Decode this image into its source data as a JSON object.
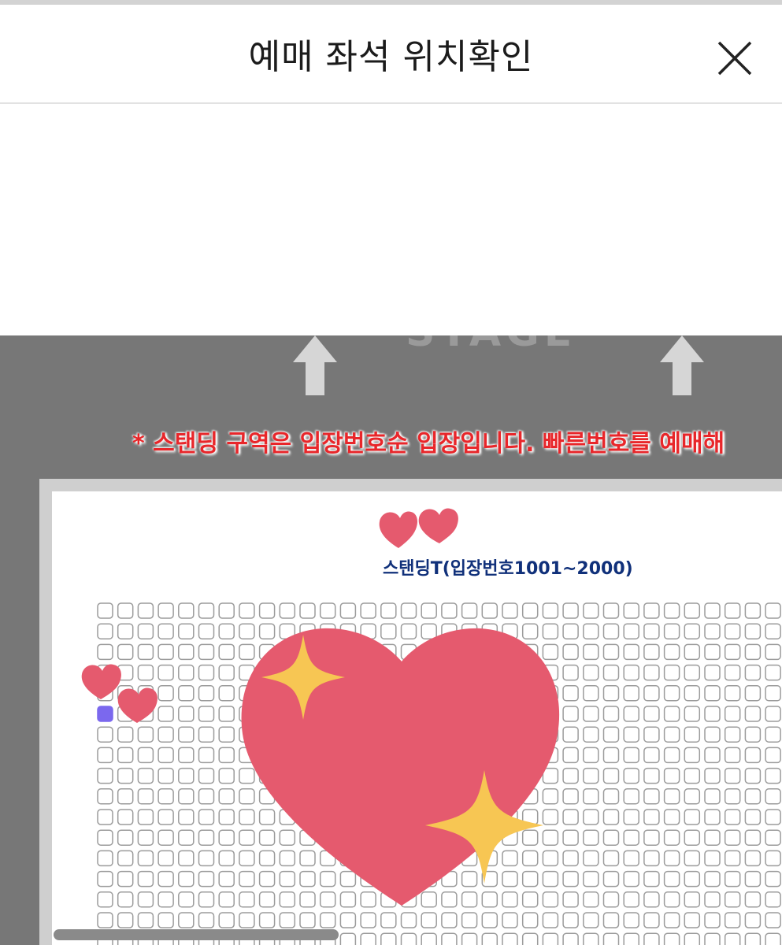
{
  "header": {
    "title": "예매 좌석 위치확인",
    "close_icon": "close-icon"
  },
  "map": {
    "stage_label": "STAGE",
    "notice": "* 스탠딩 구역은 입장번호순 입장입니다. 빠른번호를 예매해",
    "section_label": "스탠딩T(입장번호1001~2000)",
    "selected_seat_color": "#7b68ee",
    "background_color": "#777777"
  },
  "stickers": {
    "large": "sparkling-heart-icon",
    "small": "two-hearts-icon"
  }
}
